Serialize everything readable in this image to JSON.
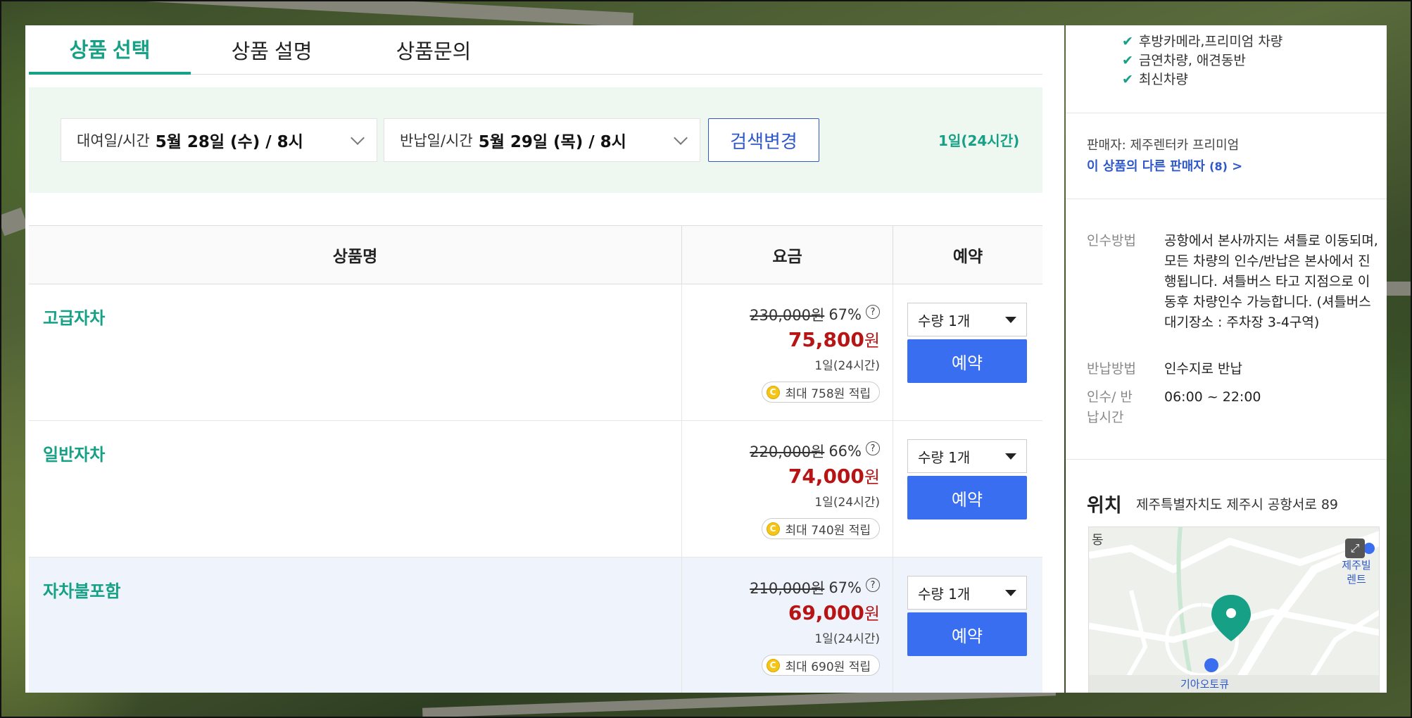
{
  "tabs": [
    {
      "label": "상품 선택",
      "active": true
    },
    {
      "label": "상품 설명",
      "active": false
    },
    {
      "label": "상품문의",
      "active": false
    }
  ],
  "search": {
    "pickup_label": "대여일/시간",
    "pickup_value": "5월 28일 (수) / 8시",
    "return_label": "반납일/시간",
    "return_value": "5월 29일 (목) / 8시",
    "change_button": "검색변경",
    "duration": "1일(24시간)"
  },
  "table": {
    "headers": {
      "name": "상품명",
      "price": "요금",
      "reserve": "예약"
    },
    "rows": [
      {
        "name": "고급자차",
        "original": "230,000원",
        "discount": "67%",
        "sale": "75,800",
        "won": "원",
        "duration": "1일(24시간)",
        "point": "최대 758원 적립",
        "qty": "수량 1개",
        "reserve": "예약"
      },
      {
        "name": "일반자차",
        "original": "220,000원",
        "discount": "66%",
        "sale": "74,000",
        "won": "원",
        "duration": "1일(24시간)",
        "point": "최대 740원 적립",
        "qty": "수량 1개",
        "reserve": "예약"
      },
      {
        "name": "자차불포함",
        "original": "210,000원",
        "discount": "67%",
        "sale": "69,000",
        "won": "원",
        "duration": "1일(24시간)",
        "point": "최대 690원 적립",
        "qty": "수량 1개",
        "reserve": "예약"
      }
    ]
  },
  "sidebar": {
    "features": [
      "후방카메라,프리미엄 차량",
      "금연차량, 애견동반",
      "최신차량"
    ],
    "seller_label": "판매자: 제주렌터카 프리미엄",
    "other_sellers": "이 상품의 다른 판매자",
    "other_sellers_count": "(8)",
    "info": [
      {
        "label": "인수방법",
        "value": "공항에서 본사까지는 셔틀로 이동되며, 모든 차량의 인수/반납은 본사에서 진행됩니다. 셔틀버스 타고 지점으로 이동후 차량인수 가능합니다. (셔틀버스 대기장소 : 주차장 3-4구역)"
      },
      {
        "label": "반납방법",
        "value": "인수지로 반납"
      },
      {
        "label": "인수/ 반납시간",
        "value": "06:00 ~ 22:00"
      }
    ],
    "location_title": "위치",
    "location_address": "제주특별자치도 제주시 공항서로 89",
    "map_labels": {
      "dong": "동",
      "poi1": "제주빌렌트",
      "poi2": "기아오토큐"
    }
  },
  "colors": {
    "accent": "#16a085",
    "primary": "#3a6ef0",
    "sale": "#b71515",
    "search_bg": "#eef8f1"
  }
}
